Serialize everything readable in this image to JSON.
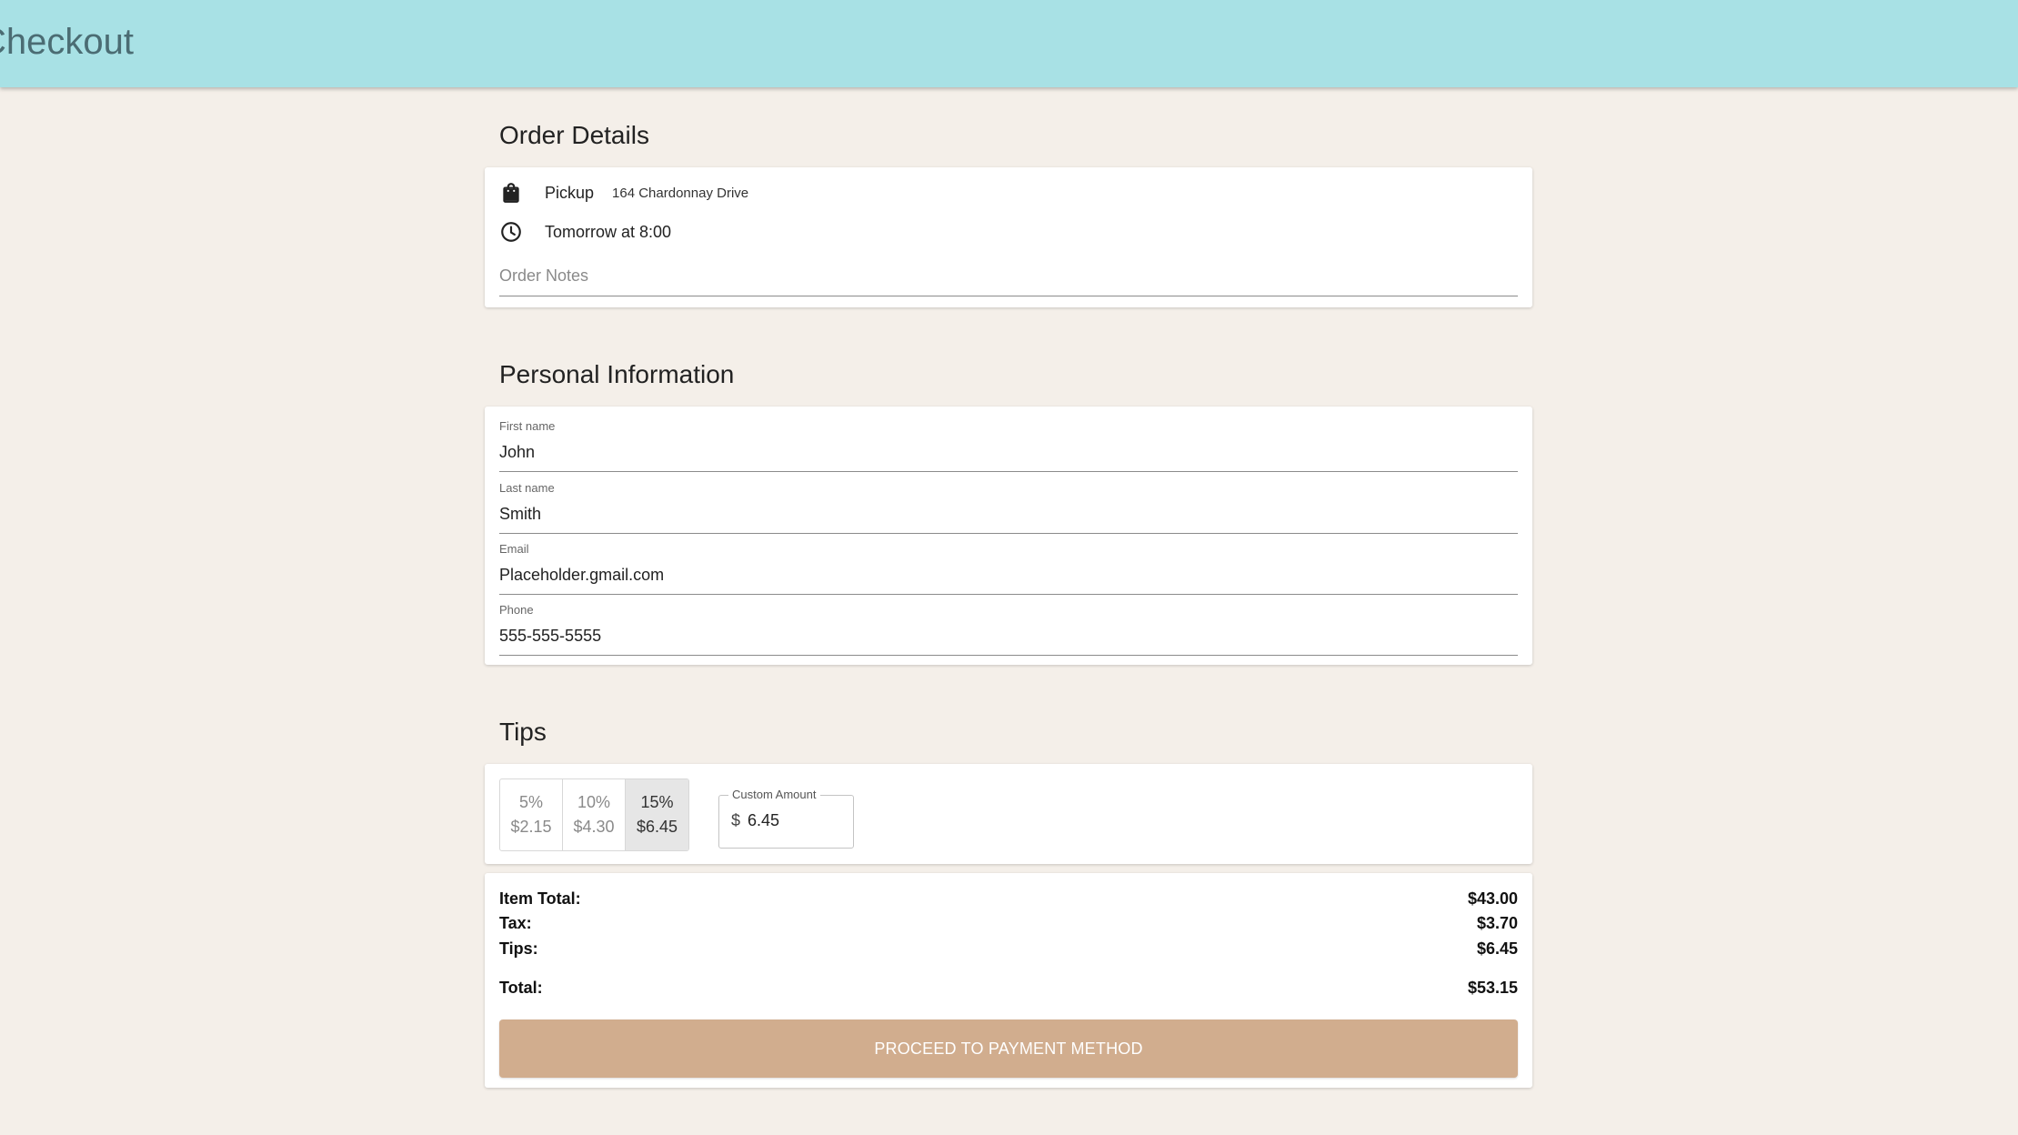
{
  "header": {
    "title": "Checkout"
  },
  "order_details": {
    "title": "Order Details",
    "mode_icon": "shopping-bag-icon",
    "mode": "Pickup",
    "address": "164 Chardonnay Drive",
    "time_icon": "clock-icon",
    "time": "Tomorrow at 8:00",
    "notes_placeholder": "Order Notes"
  },
  "personal": {
    "title": "Personal Information",
    "fields": [
      {
        "label": "First name",
        "value": "John"
      },
      {
        "label": "Last name",
        "value": "Smith"
      },
      {
        "label": "Email",
        "value": "Placeholder.gmail.com"
      },
      {
        "label": "Phone",
        "value": "555-555-5555"
      }
    ]
  },
  "tips": {
    "title": "Tips",
    "options": [
      {
        "percent": "5%",
        "amount": "$2.15",
        "selected": false
      },
      {
        "percent": "10%",
        "amount": "$4.30",
        "selected": false
      },
      {
        "percent": "15%",
        "amount": "$6.45",
        "selected": true
      }
    ],
    "custom_label": "Custom Amount",
    "custom_prefix": "$",
    "custom_value": "6.45"
  },
  "summary": {
    "item_total_label": "Item Total:",
    "item_total": "$43.00",
    "tax_label": "Tax:",
    "tax": "$3.70",
    "tips_label": "Tips:",
    "tips": "$6.45",
    "total_label": "Total:",
    "total": "$53.15",
    "proceed_label": "PROCEED TO PAYMENT METHOD"
  },
  "colors": {
    "header_bg": "#a8e1e5",
    "page_bg": "#f4efe9",
    "button_bg": "#d1ad8e"
  }
}
